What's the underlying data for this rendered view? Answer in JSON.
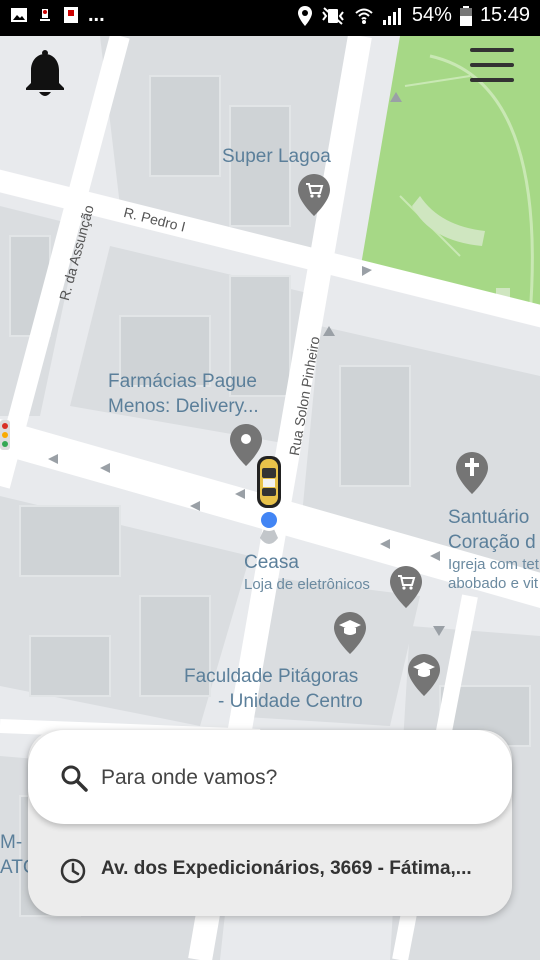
{
  "status_bar": {
    "left_icons": [
      "image-icon",
      "notification-icon",
      "app-icon"
    ],
    "overflow": "...",
    "battery": "54%",
    "time": "15:49"
  },
  "map": {
    "pois": {
      "super_lagoa": "Super Lagoa",
      "farmacias_line1": "Farmácias Pague",
      "farmacias_line2": "Menos: Delivery...",
      "ceasa": "Ceasa",
      "ceasa_sub": "Loja de eletrônicos",
      "faculdade_line1": "Faculdade Pitágoras",
      "faculdade_line2": "- Unidade Centro",
      "santuario_line1": "Santuário",
      "santuario_line2": "Coração d",
      "santuario_sub1": "Igreja com tet",
      "santuario_sub2": "abobado e vit",
      "edge_left1": "M-",
      "edge_left2": "ATC"
    },
    "streets": {
      "pedro": "R. Pedro I",
      "assuncao": "R. da Assunção",
      "solon": "Rua Solon Pinheiro"
    },
    "colors": {
      "park": "#a6d886",
      "road": "#ffffff",
      "block": "#d6d9dc",
      "label": "#5b7f9a",
      "pin": "#757575",
      "user": "#4285f4"
    }
  },
  "search_card": {
    "placeholder": "Para onde vamos?",
    "recent_address": "Av. dos Expedicionários, 3669 - Fátima,..."
  }
}
